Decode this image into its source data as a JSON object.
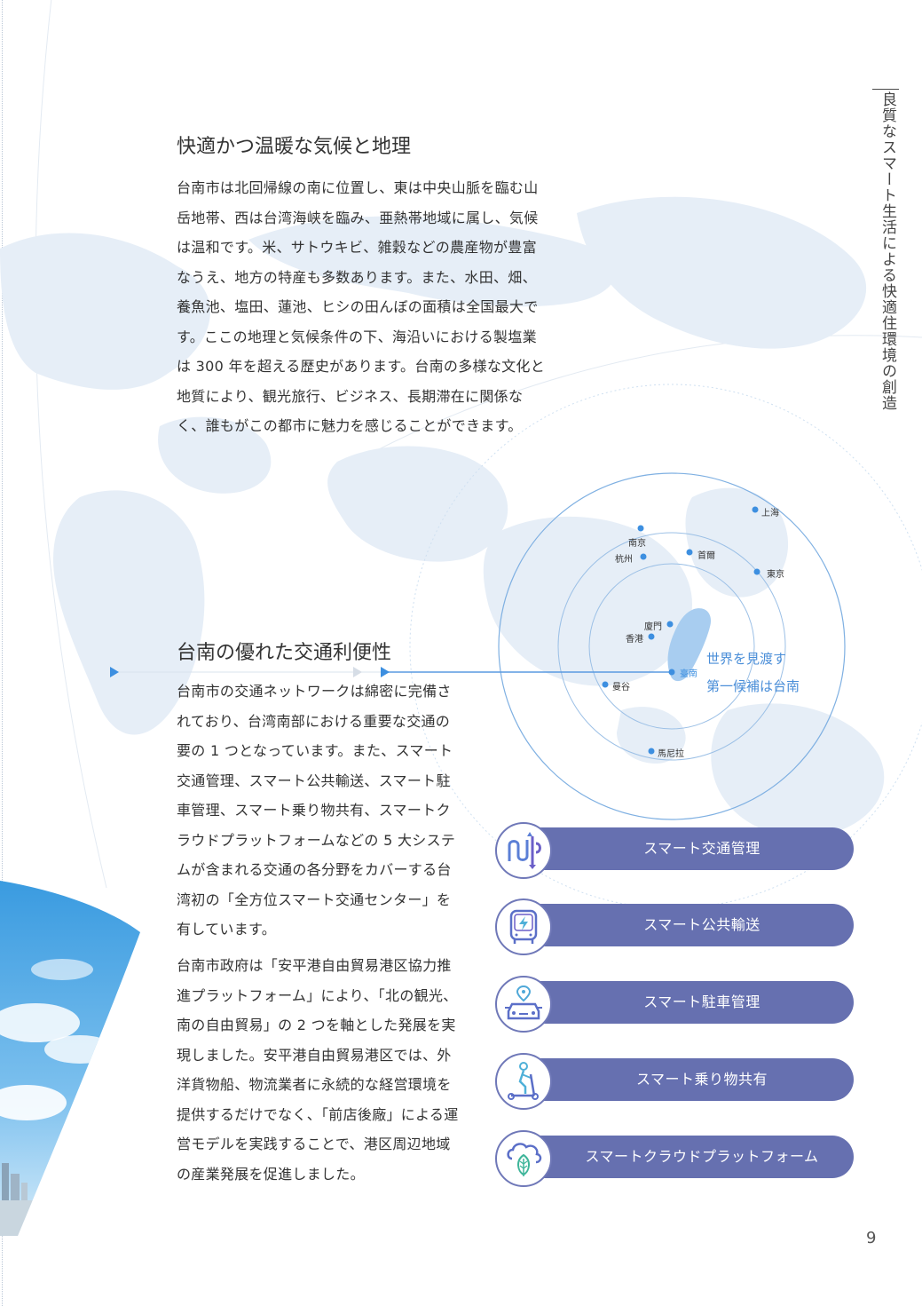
{
  "vertical_title": "良質なスマート生活による快適住環境の創造",
  "section1": {
    "title": "快適かつ温暖な気候と地理",
    "lines": [
      "台南市は北回帰線の南に位置し、東は中央山脈を臨む山",
      "岳地帯、西は台湾海峡を臨み、亜熱帯地域に属し、気候",
      "は温和です。米、サトウキビ、雑穀などの農産物が豊富",
      "なうえ、地方の特産も多数あります。また、水田、畑、",
      "養魚池、塩田、蓮池、ヒシの田んぼの面積は全国最大で",
      "す。ここの地理と気候条件の下、海沿いにおける製塩業",
      "は 300 年を超える歴史があります。台南の多様な文化と",
      "地質により、観光旅行、ビジネス、長期滞在に関係な",
      "く、誰もがこの都市に魅力を感じることができます。"
    ]
  },
  "section2": {
    "title": "台南の優れた交通利便性",
    "para1_lines": [
      "台南市の交通ネットワークは綿密に完備さ",
      "れており、台湾南部における重要な交通の",
      "要の 1 つとなっています。また、スマート",
      "交通管理、スマート公共輸送、スマート駐",
      "車管理、スマート乗り物共有、スマートク",
      "ラウドプラットフォームなどの 5 大システ",
      "ムが含まれる交通の各分野をカバーする台",
      "湾初の「全方位スマート交通センター」を",
      "有しています。"
    ],
    "para2_lines": [
      "台南市政府は「安平港自由貿易港区協力推",
      "進プラットフォーム」により、「北の観光、",
      "南の自由貿易」の 2 つを軸とした発展を実",
      "現しました。安平港自由貿易港区では、外",
      "洋貨物船、物流業者に永続的な経営環境を",
      "提供するだけでなく、「前店後廠」による運",
      "営モデルを実践することで、港区周辺地域",
      "の産業発展を促進しました。"
    ]
  },
  "map": {
    "cities": {
      "shanghai": "上海",
      "nanjing": "南京",
      "hangzhou": "杭州",
      "seoul": "首爾",
      "tokyo": "東京",
      "xiamen": "廈門",
      "hongkong": "香港",
      "tainan": "臺南",
      "bangkok": "曼谷",
      "manila": "馬尼拉"
    },
    "slogan_line1": "世界を見渡す",
    "slogan_line2": "第一候補は台南"
  },
  "systems": [
    {
      "label": "スマート交通管理",
      "icon": "traffic-route-icon"
    },
    {
      "label": "スマート公共輸送",
      "icon": "electric-bus-icon"
    },
    {
      "label": "スマート駐車管理",
      "icon": "parking-car-icon"
    },
    {
      "label": "スマート乗り物共有",
      "icon": "scooter-share-icon"
    },
    {
      "label": "スマートクラウドプラットフォーム",
      "icon": "cloud-leaf-icon"
    }
  ],
  "colors": {
    "pill": "#6670b0",
    "accent_blue": "#4a8ed8",
    "map_land": "#e3edf7"
  },
  "page_number": "9"
}
